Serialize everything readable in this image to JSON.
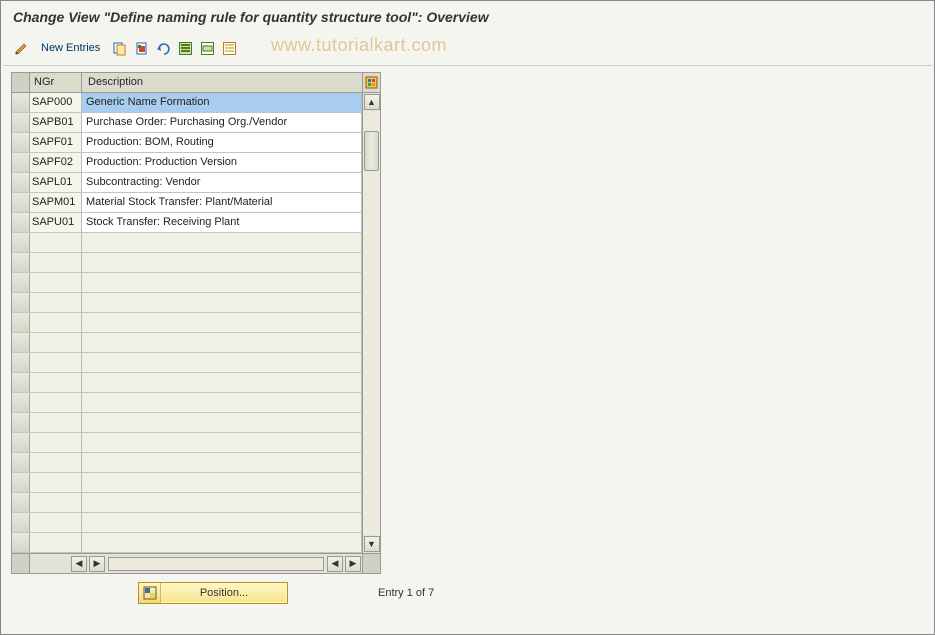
{
  "title": "Change View \"Define naming rule for quantity structure tool\": Overview",
  "watermark": "www.tutorialkart.com",
  "toolbar": {
    "new_entries_label": "New Entries",
    "icons": {
      "detail": "detail-pencil-icon",
      "copy": "copy-icon",
      "delete": "delete-icon",
      "undo": "undo-icon",
      "select_all": "select-all-icon",
      "select_block": "select-block-icon",
      "deselect_all": "deselect-all-icon"
    }
  },
  "grid": {
    "columns": {
      "ngr": "NGr",
      "description": "Description"
    },
    "config_icon": "table-settings-icon",
    "selected_index": 0,
    "rows": [
      {
        "ngr": "SAP000",
        "desc": "Generic Name Formation"
      },
      {
        "ngr": "SAPB01",
        "desc": "Purchase Order: Purchasing Org./Vendor"
      },
      {
        "ngr": "SAPF01",
        "desc": "Production: BOM, Routing"
      },
      {
        "ngr": "SAPF02",
        "desc": "Production: Production Version"
      },
      {
        "ngr": "SAPL01",
        "desc": "Subcontracting: Vendor"
      },
      {
        "ngr": "SAPM01",
        "desc": "Material Stock Transfer: Plant/Material"
      },
      {
        "ngr": "SAPU01",
        "desc": "Stock Transfer: Receiving Plant"
      }
    ],
    "empty_rows": 16
  },
  "footer": {
    "position_label": "Position...",
    "entry_status": "Entry 1 of 7"
  },
  "colors": {
    "selection": "#a8cdee",
    "button_yellow": "#f5e48a",
    "watermark": "#d6a85e"
  }
}
